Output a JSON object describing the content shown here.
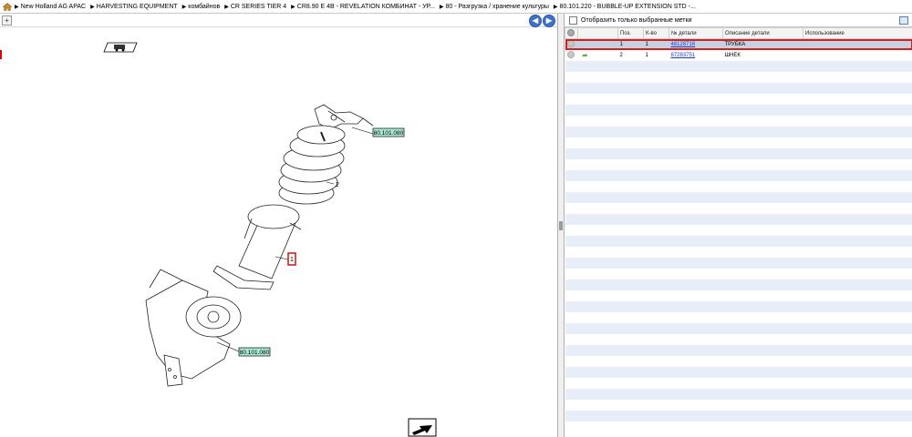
{
  "breadcrumb": {
    "items": [
      "New Holland AG APAC",
      "HARVESTING EQUIPMENT",
      "комбайнов",
      "CR SERIES TIER 4",
      "CR8.90 E 4B - REVELATION КОМБИНАТ - УР...",
      "80 - Разгрузка / хранение культуры",
      "80.101.220 - BUBBLE-UP EXTENSION STD -..."
    ]
  },
  "diagram": {
    "callout_top": "80.101.080",
    "callout_bottom": "80.101.080",
    "label_auger": "2",
    "label_tube": "1"
  },
  "filter": {
    "label": "Отобразить только выбранные метки"
  },
  "table": {
    "columns": [
      "Поз.",
      "К-во",
      "№ детали",
      "Описание детали",
      "Использование"
    ],
    "rows": [
      {
        "pos": "1",
        "qty": "1",
        "part": "48128716",
        "desc": "ТРУБКА",
        "usage": ""
      },
      {
        "pos": "2",
        "qty": "1",
        "part": "87283751",
        "desc": "ШНЕК",
        "usage": ""
      }
    ]
  },
  "colors": {
    "accent": "#3f72c8",
    "selected_outline": "#d42020",
    "link": "#1a3cd0"
  }
}
